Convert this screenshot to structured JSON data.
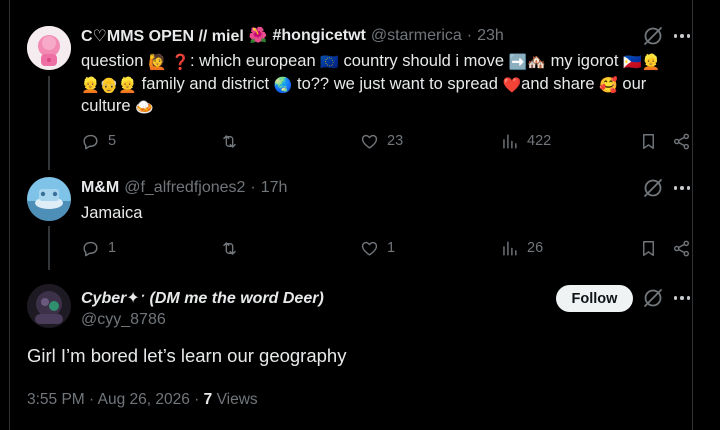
{
  "tweets": [
    {
      "name": "C♡MMS OPEN // miel",
      "name_suffix": "#hongicetwt",
      "handle": "@starmerica",
      "sep": "·",
      "time": "23h",
      "text": {
        "line1_a": "question",
        "line1_b": ": which european",
        "line1_c": "country should i move",
        "line1_d": "my igorot",
        "line2_a": "family and district",
        "line2_b": "to?? we just want to spread",
        "line2_c": "and share",
        "line2_d": "our",
        "line3_a": "culture"
      },
      "replies": "5",
      "likes": "23",
      "views": "422"
    },
    {
      "name": "M&M",
      "handle": "@f_alfredfjones2",
      "sep": "·",
      "time": "17h",
      "text": "Jamaica",
      "replies": "1",
      "likes": "1",
      "views": "26"
    }
  ],
  "main_tweet": {
    "name": "Cyber✦ˑ (DM me the word Deer)",
    "handle": "@cyy_8786",
    "follow_label": "Follow",
    "text": "Girl I’m bored let’s learn our geography",
    "timestamp": "3:55 PM · Aug 26, 2026 ·",
    "views_count": "7",
    "views_label": "Views"
  },
  "icons": {
    "reply": "reply-icon",
    "retweet": "retweet-icon",
    "like": "heart-icon",
    "views": "analytics-icon",
    "bookmark": "bookmark-icon",
    "share": "share-icon",
    "grok": "grok-icon",
    "more": "more-icon"
  },
  "colors": {
    "background": "#000000",
    "text": "#e7e9ea",
    "muted": "#71767b",
    "divider": "#2f3336",
    "follow_bg": "#eff3f4"
  }
}
